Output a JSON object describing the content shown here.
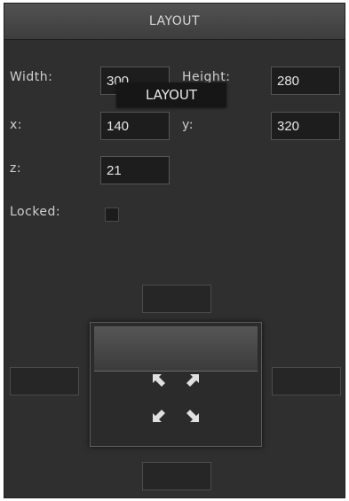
{
  "header": {
    "title": "LAYOUT"
  },
  "tooltip": {
    "text": "LAYOUT"
  },
  "fields": {
    "width": {
      "label": "Width:",
      "value": "300"
    },
    "height": {
      "label": "Height:",
      "value": "280"
    },
    "x": {
      "label": "x:",
      "value": "140"
    },
    "y": {
      "label": "y:",
      "value": "320"
    },
    "z": {
      "label": "z:",
      "value": "21"
    }
  },
  "locked": {
    "label": "Locked:",
    "checked": false
  },
  "arrows": {
    "top_left": "arrow-up-left-icon",
    "top_right": "arrow-down-left-icon",
    "bottom_left": "arrow-up-right-icon",
    "bottom_right": "arrow-down-right-icon"
  },
  "colors": {
    "panel_bg": "#2f2f2f",
    "field_bg": "#1d1d1d",
    "text": "#cfcfcf"
  }
}
